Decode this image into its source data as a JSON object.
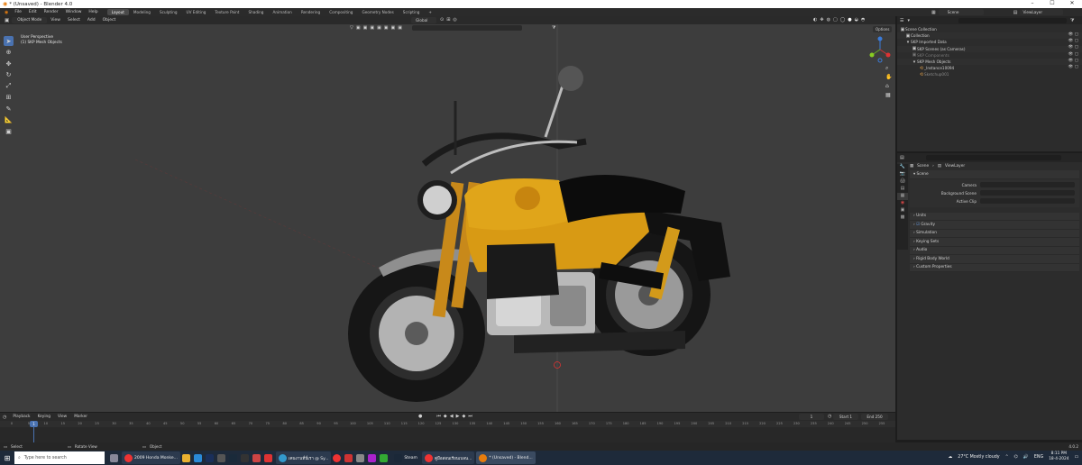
{
  "window": {
    "title": "* (Unsaved) - Blender 4.0",
    "min": "–",
    "max": "☐",
    "close": "✕"
  },
  "menu": [
    "File",
    "Edit",
    "Render",
    "Window",
    "Help"
  ],
  "workspaces": [
    "Layout",
    "Modeling",
    "Sculpting",
    "UV Editing",
    "Texture Paint",
    "Shading",
    "Animation",
    "Rendering",
    "Compositing",
    "Geometry Nodes",
    "Scripting"
  ],
  "scene": {
    "name": "Scene",
    "view_layer": "ViewLayer"
  },
  "viewport_header": {
    "mode": "Object Mode",
    "menus": [
      "View",
      "Select",
      "Add",
      "Object"
    ],
    "transform": "Global",
    "options": "Options"
  },
  "viewport": {
    "perspective": "User Perspective",
    "collection": "(1) SKP Mesh Objects"
  },
  "outliner": {
    "items": [
      {
        "label": "Scene Collection",
        "depth": 0
      },
      {
        "label": "Collection",
        "depth": 1
      },
      {
        "label": "SKP Imported Data",
        "depth": 1
      },
      {
        "label": "SKP Scenes (as Cameras)",
        "depth": 2
      },
      {
        "label": "SKP Components",
        "depth": 2
      },
      {
        "label": "SKP Mesh Objects",
        "depth": 2
      },
      {
        "label": "_Instance10094",
        "depth": 3
      },
      {
        "label": "Sketchup001",
        "depth": 3
      }
    ]
  },
  "properties": {
    "breadcrumb": [
      "Scene",
      "ViewLayer"
    ],
    "section": "Scene",
    "fields": [
      {
        "label": "Camera",
        "value": ""
      },
      {
        "label": "Background Scene",
        "value": ""
      },
      {
        "label": "Active Clip",
        "value": ""
      }
    ],
    "panels": [
      "Units",
      "Gravity",
      "Simulation",
      "Keying Sets",
      "Audio",
      "Rigid Body World",
      "Custom Properties"
    ]
  },
  "timeline": {
    "menus": [
      "Playback",
      "Keying",
      "View",
      "Marker"
    ],
    "current_frame": "1",
    "start": "Start 1",
    "end": "End 250",
    "ticks": [
      "0",
      "5",
      "10",
      "15",
      "20",
      "25",
      "30",
      "35",
      "40",
      "45",
      "50",
      "55",
      "60",
      "65",
      "70",
      "75",
      "80",
      "85",
      "90",
      "95",
      "100",
      "105",
      "110",
      "115",
      "120",
      "125",
      "130",
      "135",
      "140",
      "145",
      "150",
      "155",
      "160",
      "165",
      "170",
      "175",
      "180",
      "185",
      "190",
      "195",
      "200",
      "205",
      "210",
      "215",
      "220",
      "225",
      "230",
      "235",
      "240",
      "245",
      "250",
      "255"
    ]
  },
  "status": {
    "select": "Select",
    "rotate": "Rotate View",
    "object": "Object",
    "version": "4.0.2"
  },
  "taskbar": {
    "search": "Type here to search",
    "apps": [
      "2009 Honda Monke...",
      "เคนงานที่นี่เรา @ Sy...",
      "Steam",
      "คู่มือสอนเรียนเบลน...",
      "* (Unsaved) - Blend..."
    ],
    "weather": "27°C  Mostly cloudy",
    "time": "8:11 PM",
    "date": "18-4-2024",
    "lang": "ENG"
  },
  "colors": {
    "accent": "#4a72b0",
    "viewport": "#3d3d3d",
    "bike_yellow": "#d89a14"
  }
}
